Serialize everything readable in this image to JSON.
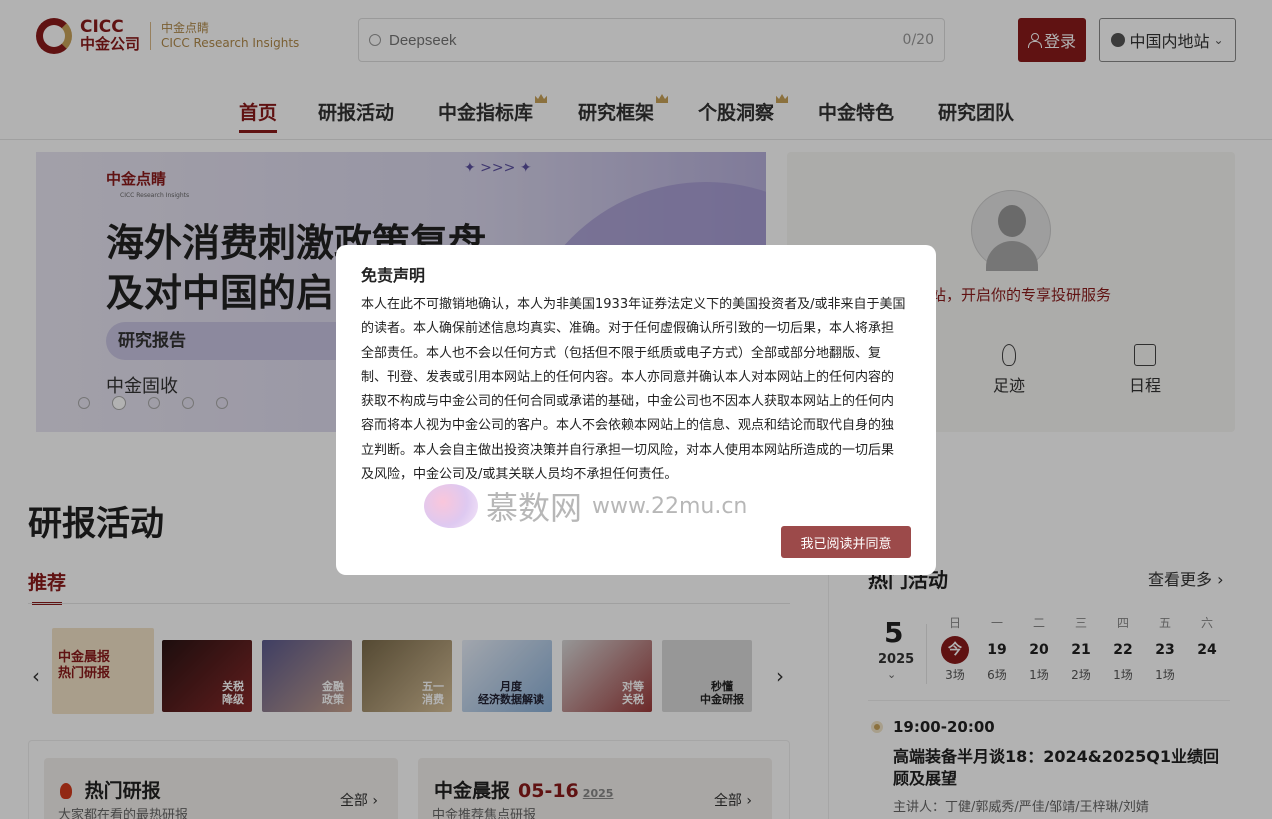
{
  "header": {
    "logo_main": "CICC",
    "logo_cn": "中金公司",
    "logo_sub_cn": "中金点睛",
    "logo_sub_en": "CICC Research Insights",
    "search_placeholder": "Deepseek",
    "search_count": "0/20",
    "login_label": "登录",
    "site_label": "中国内地站"
  },
  "nav": {
    "items": [
      {
        "label": "首页"
      },
      {
        "label": "研报活动"
      },
      {
        "label": "中金指标库"
      },
      {
        "label": "研究框架"
      },
      {
        "label": "个股洞察"
      },
      {
        "label": "中金特色"
      },
      {
        "label": "研究团队"
      }
    ]
  },
  "banner": {
    "brand": "中金点睛",
    "brand_sub": "CICC Research Insights",
    "arrows": "✦ >>> ✦",
    "title_line1": "海外消费刺激政策复盘",
    "title_line2": "及对中国的启",
    "tag": "研究报告",
    "sub": "中金固收"
  },
  "profile": {
    "text": "站，开启你的专享投研服务",
    "actions": [
      {
        "label": "足迹"
      },
      {
        "label": "日程"
      }
    ]
  },
  "section": {
    "title": "研报活动",
    "tab": "推荐"
  },
  "carousel": {
    "active_label_line1": "中金晨报",
    "active_label_line2": "热门研报",
    "thumbs": [
      {
        "label": "关税\n降级"
      },
      {
        "label": "金融\n政策"
      },
      {
        "label": "五一\n消费"
      },
      {
        "label": "月度\n经济数据解读"
      },
      {
        "label": "对等\n关税"
      },
      {
        "label": "秒懂\n中金研报"
      }
    ]
  },
  "cards": {
    "hot": {
      "title": "热门研报",
      "sub": "大家都在看的最热研报",
      "all": "全部"
    },
    "morning": {
      "title": "中金晨报",
      "date": "05-16",
      "year": "2025",
      "sub": "中金推荐焦点研报",
      "all": "全部"
    }
  },
  "events": {
    "title": "热门活动",
    "more": "查看更多",
    "month": "5",
    "year": "2025",
    "weekdays": [
      "日",
      "一",
      "二",
      "三",
      "四",
      "五",
      "六"
    ],
    "days": [
      "今",
      "19",
      "20",
      "21",
      "22",
      "23",
      "24"
    ],
    "counts": [
      "3场",
      "6场",
      "1场",
      "2场",
      "1场",
      "1场",
      ""
    ],
    "item": {
      "time": "19:00-20:00",
      "title": "高端装备半月谈18：2024&2025Q1业绩回顾及展望",
      "speakers": "主讲人：丁健/郭威秀/严佳/邹靖/王梓琳/刘婧"
    }
  },
  "modal": {
    "title": "免责声明",
    "body": "本人在此不可撤销地确认，本人为非美国1933年证券法定义下的美国投资者及/或非来自于美国的读者。本人确保前述信息均真实、准确。对于任何虚假确认所引致的一切后果，本人将承担全部责任。本人也不会以任何方式（包括但不限于纸质或电子方式）全部或部分地翻版、复制、刊登、发表或引用本网站上的任何内容。本人亦同意并确认本人对本网站上的任何内容的获取不构成与中金公司的任何合同或承诺的基础，中金公司也不因本人获取本网站上的任何内容而将本人视为中金公司的客户。本人不会依赖本网站上的信息、观点和结论而取代自身的独立判断。本人会自主做出投资决策并自行承担一切风险，对本人使用本网站所造成的一切后果及风险，中金公司及/或其关联人员均不承担任何责任。",
    "button": "我已阅读并同意",
    "watermark_cn": "慕数网",
    "watermark_url": "www.22mu.cn"
  }
}
